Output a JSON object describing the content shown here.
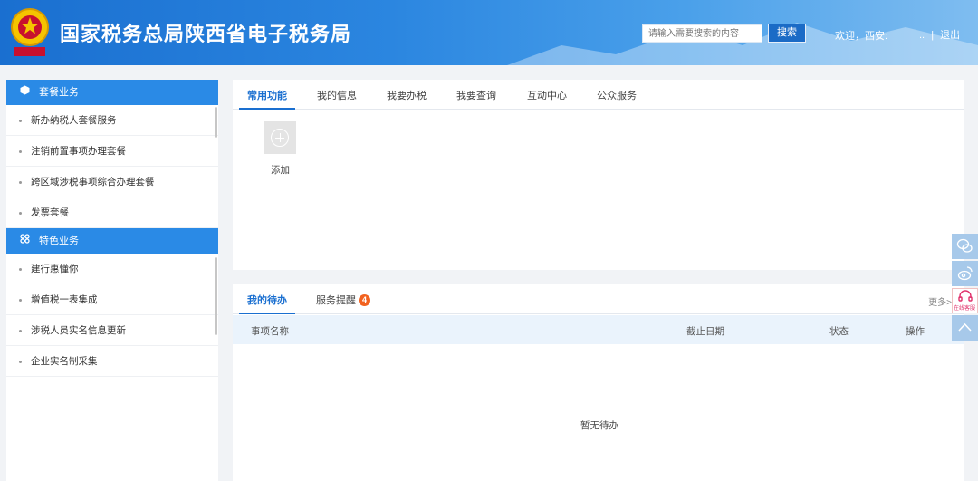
{
  "header": {
    "title": "国家税务总局陕西省电子税务局",
    "search_placeholder": "请输入需要搜索的内容",
    "search_button": "搜索",
    "welcome": "欢迎，西安:",
    "user_suffix": "..",
    "separator": "|",
    "logout": "退出"
  },
  "sidebar": {
    "sections": [
      {
        "title": "套餐业务",
        "items": [
          "新办纳税人套餐服务",
          "注销前置事项办理套餐",
          "跨区域涉税事项综合办理套餐",
          "发票套餐"
        ]
      },
      {
        "title": "特色业务",
        "items": [
          "建行惠懂你",
          "增值税一表集成",
          "涉税人员实名信息更新",
          "企业实名制采集"
        ]
      }
    ]
  },
  "main": {
    "tabs": [
      "常用功能",
      "我的信息",
      "我要办税",
      "我要查询",
      "互动中心",
      "公众服务"
    ],
    "add_label": "添加"
  },
  "todo": {
    "tabs": [
      "我的待办",
      "服务提醒"
    ],
    "badge": "4",
    "more": "更多>",
    "columns": [
      "事项名称",
      "截止日期",
      "状态",
      "操作"
    ],
    "empty": "暂无待办"
  },
  "float": {
    "service_label": "在线客服"
  },
  "colors": {
    "primary": "#1a6fd0",
    "sidebar_header": "#2a8ae6",
    "badge": "#f2621f"
  }
}
